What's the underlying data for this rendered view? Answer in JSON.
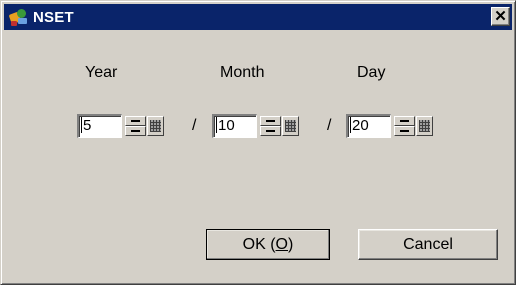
{
  "window": {
    "title": "NSET",
    "close_glyph": "✕",
    "icon": "nset-app-icon"
  },
  "labels": {
    "year": "Year",
    "month": "Month",
    "day": "Day"
  },
  "fields": {
    "year_value": "5",
    "month_value": "10",
    "day_value": "20",
    "separator": "/"
  },
  "buttons": {
    "ok_prefix": "OK (",
    "ok_accel": "O",
    "ok_suffix": ")",
    "cancel": "Cancel"
  },
  "icons": {
    "spinner": "spin-updown-icon",
    "keypad": "keypad-icon"
  },
  "colors": {
    "titlebar": "#0a246a",
    "face": "#d4d0c8"
  }
}
